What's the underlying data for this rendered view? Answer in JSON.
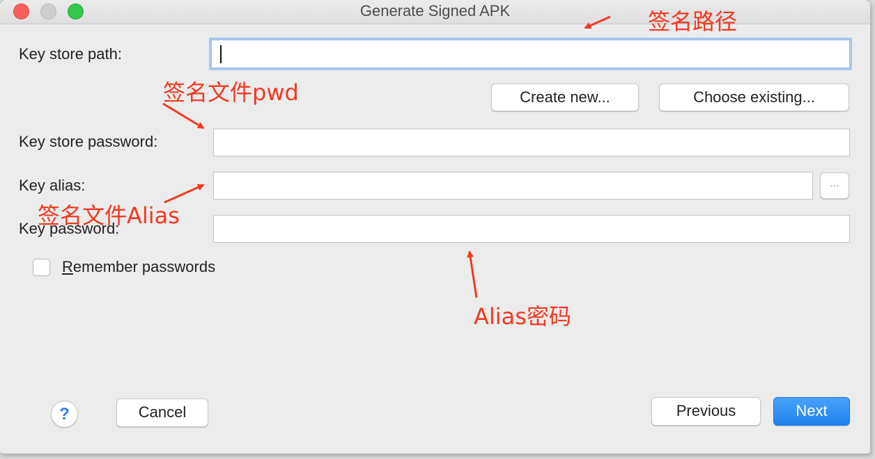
{
  "window": {
    "title": "Generate Signed APK"
  },
  "form": {
    "keystore_path": {
      "label": "Key store path:",
      "value": ""
    },
    "create_new_label": "Create new...",
    "choose_existing_label": "Choose existing...",
    "keystore_password": {
      "label": "Key store password:",
      "value": ""
    },
    "key_alias": {
      "label": "Key alias:",
      "value": "",
      "browse_label": "..."
    },
    "key_password": {
      "label": "Key password:",
      "value": ""
    },
    "remember_passwords": {
      "label": "Remember passwords",
      "checked": false
    }
  },
  "footer": {
    "help_label": "?",
    "cancel_label": "Cancel",
    "previous_label": "Previous",
    "next_label": "Next"
  },
  "annotations": {
    "path": "签名路径",
    "pwd": "签名文件pwd",
    "alias": "签名文件Alias",
    "alias_pwd": "Alias密码",
    "color": "#f2391f"
  },
  "colors": {
    "accent": "#1e82ee",
    "focus_ring": "#a9c8ee",
    "close": "#fc605c",
    "maximize": "#34c84a"
  }
}
